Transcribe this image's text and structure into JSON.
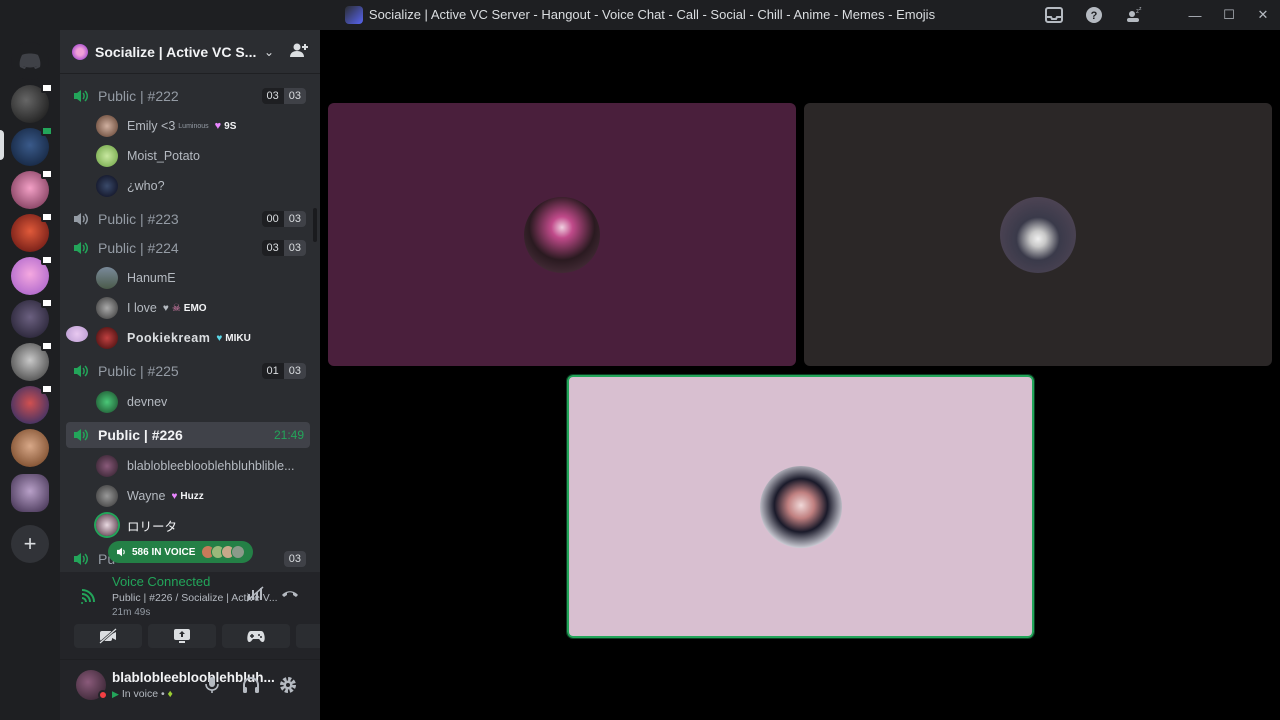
{
  "window": {
    "title": "Socialize | Active VC Server - Hangout - Voice Chat - Call - Social - Chill - Anime - Memes - Emojis",
    "icons": [
      "inbox-icon",
      "help-icon",
      "sleep-icon"
    ],
    "controls": [
      "minimize",
      "maximize",
      "close"
    ]
  },
  "server": {
    "name": "Socialize | Active VC S...",
    "header_icon": "server-icon",
    "invite_icon": "invite-people-icon"
  },
  "channels": [
    {
      "name": "Public | #222",
      "count_a": "03",
      "count_b": "03",
      "members": [
        {
          "name": "Emily <3",
          "sub": "Luminous",
          "tag": "9S"
        },
        {
          "name": "Moist_Potato"
        },
        {
          "name": "¿who?"
        }
      ]
    },
    {
      "name": "Public | #223",
      "count_a": "00",
      "count_b": "03",
      "members": []
    },
    {
      "name": "Public | #224",
      "count_a": "03",
      "count_b": "03",
      "members": [
        {
          "name": "HanumE"
        },
        {
          "name": "I love",
          "tag": "EMO"
        },
        {
          "name": "Pookiekream",
          "tag": "MIKU"
        }
      ]
    },
    {
      "name": "Public | #225",
      "count_a": "01",
      "count_b": "03",
      "members": [
        {
          "name": "devnev"
        }
      ]
    },
    {
      "name": "Public | #226",
      "timer": "21:49",
      "active": true,
      "members": [
        {
          "name": "blablobleeblooblehbluhblible..."
        },
        {
          "name": "Wayne",
          "tag": "Huzz"
        },
        {
          "name": "ロリータ"
        }
      ]
    },
    {
      "name": "Pu",
      "count_b": "03"
    }
  ],
  "voice_pill": {
    "label": "586 IN VOICE"
  },
  "voice_panel": {
    "status": "Voice Connected",
    "channel": "Public | #226 / Socialize | Active V...",
    "elapsed": "21m 49s",
    "buttons": [
      "camera-off-icon",
      "screen-share-icon",
      "activity-icon",
      "soundboard-icon"
    ]
  },
  "user_panel": {
    "name": "blablobleeblooblehbluh...",
    "display": "blablobleeblooble h...",
    "status": "In voice •"
  },
  "colors": {
    "green": "#23a55a",
    "tile1": "#4a1f3c",
    "tile2": "#2b2727",
    "tile3": "#d8bfd0"
  }
}
